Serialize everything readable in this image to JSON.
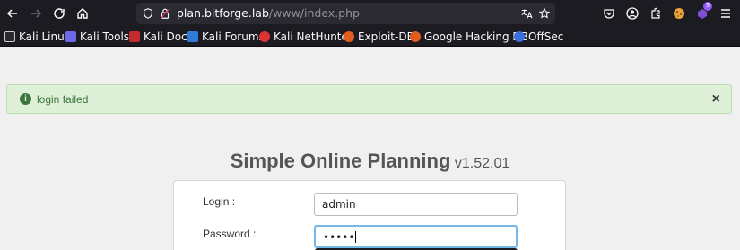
{
  "browser": {
    "url_host": "plan.bitforge.lab",
    "url_path": "/www/index.php",
    "extension_badge": "9"
  },
  "bookmarks": [
    {
      "label": "Kali Linux",
      "icon": "kali-dragon-icon"
    },
    {
      "label": "Kali Tools",
      "icon": "kali-tools-icon"
    },
    {
      "label": "Kali Docs",
      "icon": "kali-docs-icon"
    },
    {
      "label": "Kali Forums",
      "icon": "kali-forums-icon"
    },
    {
      "label": "Kali NetHunter",
      "icon": "nethunter-icon"
    },
    {
      "label": "Exploit-DB",
      "icon": "exploit-db-icon"
    },
    {
      "label": "Google Hacking DB",
      "icon": "ghdb-icon"
    },
    {
      "label": "OffSec",
      "icon": "offsec-icon"
    }
  ],
  "alert": {
    "message": "login failed",
    "close": "×",
    "info": "i"
  },
  "app": {
    "title": "Simple Online Planning",
    "version": "v1.52.01"
  },
  "form": {
    "login_label": "Login :",
    "login_value": "admin",
    "password_label": "Password :",
    "password_value": "•••••"
  },
  "colors": {
    "alert_bg": "#dff0d8",
    "alert_text": "#3c763d",
    "toolbar_bg": "#1c1b22"
  }
}
